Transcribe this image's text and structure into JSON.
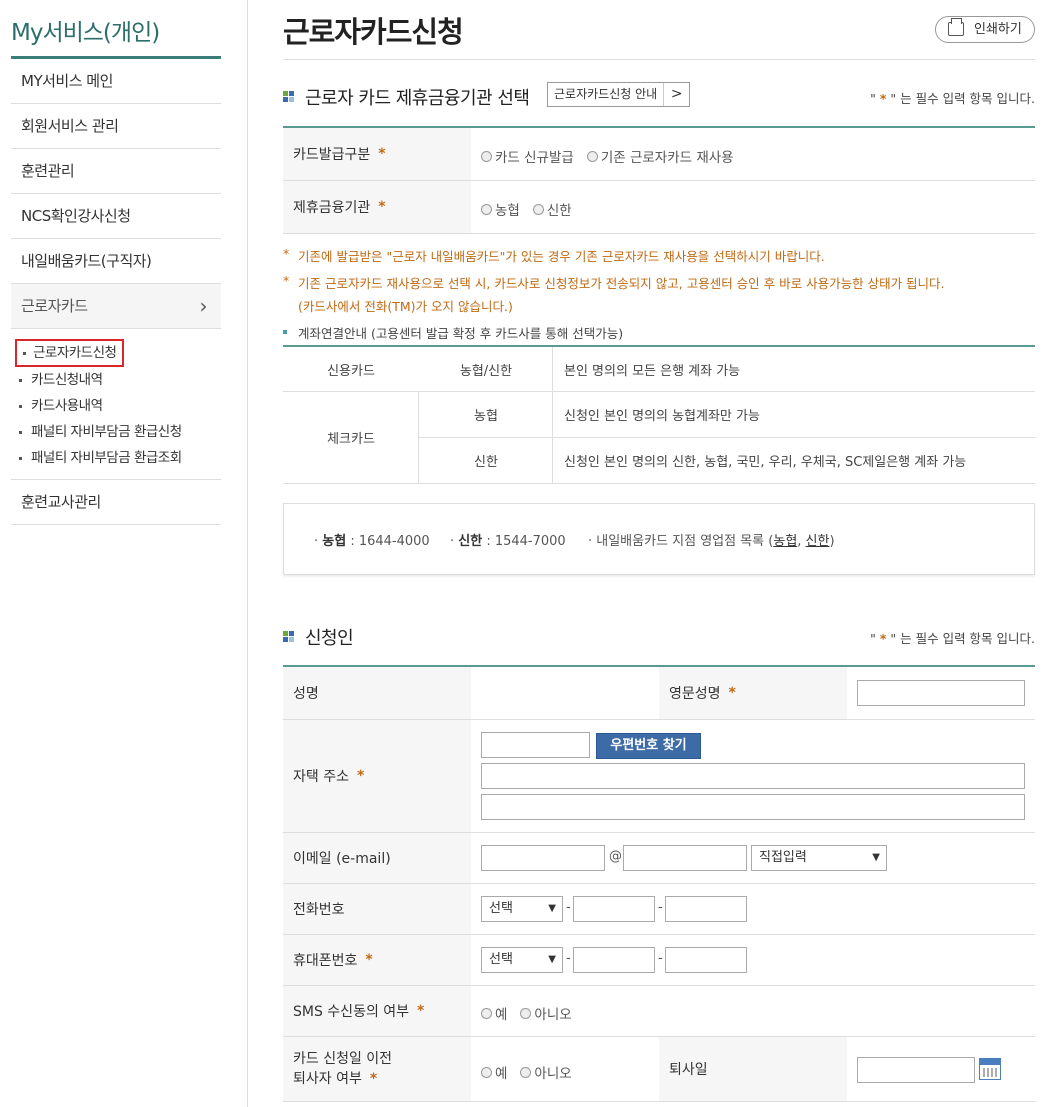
{
  "sidebar": {
    "title": "My서비스(개인)",
    "items": [
      {
        "label": "MY서비스 메인"
      },
      {
        "label": "회원서비스 관리"
      },
      {
        "label": "훈련관리"
      },
      {
        "label": "NCS확인강사신청"
      },
      {
        "label": "내일배움카드(구직자)"
      },
      {
        "label": "근로자카드"
      }
    ],
    "sub_items": [
      {
        "label": "근로자카드신청"
      },
      {
        "label": "카드신청내역"
      },
      {
        "label": "카드사용내역"
      },
      {
        "label": "패널티 자비부담금 환급신청"
      },
      {
        "label": "패널티 자비부담금 환급조회"
      }
    ],
    "last_item": "훈련교사관리"
  },
  "page": {
    "title": "근로자카드신청",
    "print_label": "인쇄하기"
  },
  "section1": {
    "title": "근로자 카드 제휴금융기관 선택",
    "guide_button": "근로자카드신청 안내",
    "guide_arrow": ">",
    "required_note_prefix": "\" ",
    "required_star": "*",
    "required_note_suffix": " \" 는 필수 입력 항목 입니다.",
    "rows": [
      {
        "label": "카드발급구분",
        "options": [
          "카드 신규발급",
          "기존 근로자카드 재사용"
        ]
      },
      {
        "label": "제휴금융기관",
        "options": [
          "농협",
          "신한"
        ]
      }
    ],
    "notes": [
      "기존에 발급받은 \"근로자 내일배움카드\"가 있는 경우 기존 근로자카드 재사용을 선택하시기 바랍니다.",
      "기존 근로자카드 재사용으로 선택 시, 카드사로 신청정보가 전송되지 않고, 고용센터 승인 후 바로 사용가능한 상태가 됩니다.",
      "(카드사에서 전화(TM)가 오지 않습니다.)"
    ],
    "account_note": "계좌연결안내 (고용센터 발급 확정 후 카드사를 통해 선택가능)",
    "account_table": {
      "credit": {
        "type": "신용카드",
        "bank": "농협/신한",
        "desc": "본인 명의의 모든 은행 계좌 가능"
      },
      "check": {
        "type": "체크카드",
        "rows": [
          {
            "bank": "농협",
            "desc": "신청인 본인 명의의 농협계좌만 가능"
          },
          {
            "bank": "신한",
            "desc": "신청인 본인 명의의 신한, 농협, 국민, 우리, 우체국, SC제일은행 계좌 가능"
          }
        ]
      }
    },
    "contacts": {
      "nh_label": "농협",
      "nh_phone": " : 1644-4000",
      "sh_label": "신한",
      "sh_phone": " : 1544-7000",
      "branch_text": "내일배움카드 지점 영업점 목록 (",
      "branch_nh": "농협",
      "branch_sep": ", ",
      "branch_sh": "신한",
      "branch_end": ")"
    }
  },
  "section2": {
    "title": "신청인",
    "required_note_prefix": "\" ",
    "required_star": "*",
    "required_note_suffix": " \" 는 필수 입력 항목 입니다.",
    "name_label": "성명",
    "eng_name_label": "영문성명",
    "address_label": "자택 주소",
    "zip_button": "우편번호 찾기",
    "email_label": "이메일 (e-mail)",
    "email_at": "@",
    "email_domain_select": "직접입력",
    "phone_label": "전화번호",
    "phone_select": "선택",
    "mobile_label": "휴대폰번호",
    "mobile_select": "선택",
    "sms_label": "SMS 수신동의 여부",
    "sms_options": [
      "예",
      "아니오"
    ],
    "retire_label_1": "카드 신청일 이전",
    "retire_label_2": "퇴사자 여부",
    "retire_options": [
      "예",
      "아니오"
    ],
    "retire_date_label": "퇴사일",
    "dash": "-"
  },
  "colors": {
    "accent": "#3a7e79",
    "required": "#c06a14",
    "button": "#3d6ba5",
    "highlight": "#d9262b"
  }
}
